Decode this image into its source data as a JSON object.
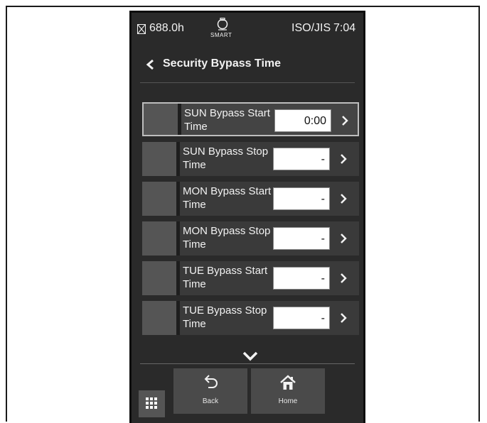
{
  "status_bar": {
    "hours": "688.0h",
    "mode": "SMART",
    "standard": "ISO/JIS",
    "time": "7:04"
  },
  "header": {
    "title": "Security Bypass Time"
  },
  "rows": [
    {
      "label": "SUN Bypass Start Time",
      "value": "0:00"
    },
    {
      "label": "SUN Bypass Stop Time",
      "value": "-"
    },
    {
      "label": "MON Bypass Start Time",
      "value": "-"
    },
    {
      "label": "MON Bypass Stop Time",
      "value": "-"
    },
    {
      "label": "TUE Bypass Start Time",
      "value": "-"
    },
    {
      "label": "TUE Bypass Stop Time",
      "value": "-"
    }
  ],
  "nav": {
    "back_label": "Back",
    "home_label": "Home"
  },
  "icons": {
    "hours": "hourglass-icon",
    "smart": "smart-bulb-icon",
    "back": "chevron-left-icon",
    "row_action": "chevron-right-icon",
    "scroll": "chevron-down-icon",
    "menu": "grid-icon",
    "undo": "undo-arrow-icon",
    "home": "home-icon"
  }
}
